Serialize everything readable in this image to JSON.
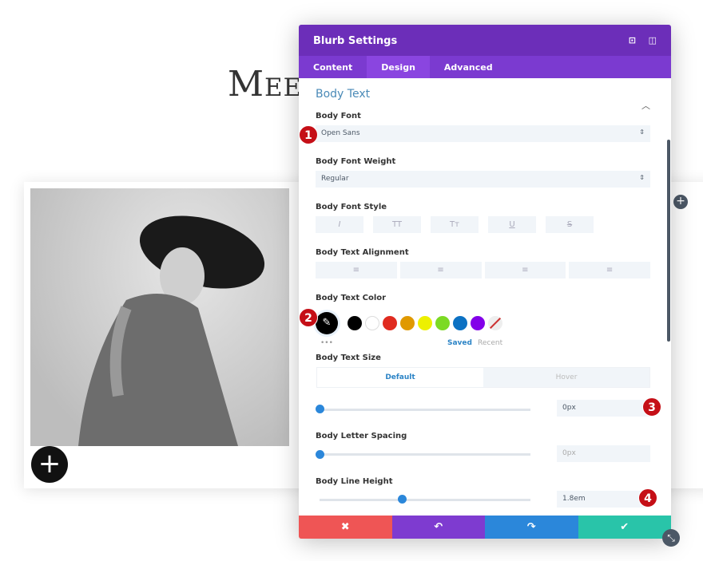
{
  "page": {
    "heading": "Meet"
  },
  "panel": {
    "title": "Blurb Settings",
    "tabs": [
      {
        "label": "Content"
      },
      {
        "label": "Design"
      },
      {
        "label": "Advanced"
      }
    ],
    "section_title": "Body Text",
    "body_font": {
      "label": "Body Font",
      "value": "Open Sans"
    },
    "body_font_weight": {
      "label": "Body Font Weight",
      "value": "Regular"
    },
    "body_font_style": {
      "label": "Body Font Style",
      "buttons": [
        "I",
        "TT",
        "Tт",
        "U",
        "S"
      ]
    },
    "body_text_alignment": {
      "label": "Body Text Alignment",
      "buttons": [
        "align-left",
        "align-center",
        "align-right",
        "justify"
      ]
    },
    "body_text_color": {
      "label": "Body Text Color",
      "selected": "#000000",
      "swatches": [
        "#000000",
        "#ffffff",
        "#e02b20",
        "#e09900",
        "#edf000",
        "#7cda24",
        "#0c71c3",
        "#8300e9"
      ],
      "saved_label": "Saved",
      "recent_label": "Recent",
      "more": "•••"
    },
    "body_text_size": {
      "label": "Body Text Size",
      "tabs": [
        "Default",
        "Hover"
      ],
      "value": "0px",
      "slider": 0
    },
    "body_letter_spacing": {
      "label": "Body Letter Spacing",
      "value": "0px",
      "slider": 0
    },
    "body_line_height": {
      "label": "Body Line Height",
      "value": "1.8em",
      "slider": 0.4
    },
    "badges": [
      "1",
      "2",
      "3",
      "4"
    ],
    "footer": {
      "cancel": "✖",
      "undo": "↶",
      "redo": "↷",
      "save": "✔"
    },
    "colors": {
      "header": "#6c2eb9",
      "tabs": "#7b3ad0",
      "cancel": "#ef5555",
      "undo": "#7e3bd0",
      "redo": "#2b87da",
      "save": "#29c4a9"
    }
  }
}
